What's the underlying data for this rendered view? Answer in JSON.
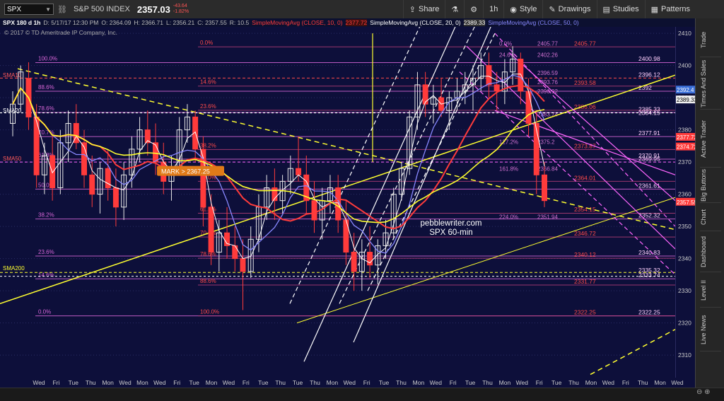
{
  "toolbar": {
    "symbol": "SPX",
    "description": "S&P 500 INDEX",
    "last": "2357.03",
    "change": "-43.64",
    "change_pct": "-1.82%",
    "buttons": [
      {
        "label": "Share",
        "icon": "share-icon"
      },
      {
        "label": "",
        "icon": "flask-icon"
      },
      {
        "label": "",
        "icon": "gear-icon"
      },
      {
        "label": "1h",
        "icon": ""
      },
      {
        "label": "Style",
        "icon": "eye-icon"
      },
      {
        "label": "Drawings",
        "icon": "pencil-icon"
      },
      {
        "label": "Studies",
        "icon": "studies-icon"
      },
      {
        "label": "Patterns",
        "icon": "patterns-icon"
      }
    ]
  },
  "infobar": {
    "title": "SPX 180 d 1h",
    "date": "D: 5/17/17 12:30 PM",
    "open": "O: 2364.09",
    "high": "H: 2366.71",
    "low": "L: 2356.21",
    "close": "C: 2357.55",
    "range": "R: 10.5",
    "sma10": "SimpleMovingAvg (CLOSE, 10, 0)",
    "sma10_val": "2377.72",
    "sma20": "SimpleMovingAvg (CLOSE, 20, 0)",
    "sma20_val": "2389.33",
    "sma50": "SimpleMovingAvg (CLOSE, 50, 0)",
    "copyright": "© 2017 © TD Ameritrade IP Company, Inc."
  },
  "sidebar": [
    "Trade",
    "Times And Sales",
    "Active Trader",
    "Big Buttons",
    "Chart",
    "Dashboard",
    "Level II",
    "Live News"
  ],
  "colors": {
    "background": "#0d0f3a",
    "up": "#e8e8e8",
    "down": "#ff3b3b",
    "fib": "#d866d8",
    "sma10": "#ff3b3b",
    "sma20": "#ffffff",
    "sma50": "#8888ff",
    "ma200": "#ffff30",
    "trend": "#ffff30",
    "channel": "#ffffff",
    "pink_channel": "#ff66ff"
  },
  "chart_data": {
    "type": "candlestick",
    "x_ticks": [
      "Wed",
      "Fri",
      "Tue",
      "Thu",
      "Mon",
      "Wed",
      "Mon",
      "Wed",
      "Fri",
      "Tue",
      "Mon",
      "Wed",
      "Fri",
      "Tue",
      "Thu",
      "Tue",
      "Thu",
      "Mon",
      "Wed",
      "Fri",
      "Tue",
      "Thu",
      "Mon",
      "Wed",
      "Fri",
      "Tue",
      "Thu",
      "Mon",
      "Wed",
      "Fri",
      "Tue",
      "Thu",
      "Mon",
      "Wed",
      "Fri",
      "Thu",
      "Mon",
      "Wed"
    ],
    "y_ticks": [
      2310,
      2320,
      2330,
      2340,
      2350,
      2360,
      2370,
      2380,
      2390,
      2400,
      2410
    ],
    "ylim": [
      2303,
      2412
    ],
    "price_markers": [
      {
        "label": "2392.4",
        "value": 2392.4,
        "color": "#3a6fd8"
      },
      {
        "label": "2389.33",
        "value": 2389.33,
        "color": "#ffffff"
      },
      {
        "label": "2377.72",
        "value": 2377.72,
        "color": "#ff3b3b"
      },
      {
        "label": "2374.72",
        "value": 2374.72,
        "color": "#ff3b3b"
      },
      {
        "label": "2357.55",
        "value": 2357.55,
        "color": "#ff3b3b"
      }
    ],
    "fib_pct_left": [
      {
        "label": "100.0%",
        "value": 2400.9
      },
      {
        "label": "88.6%",
        "value": 2392.0
      },
      {
        "label": "78.6%",
        "value": 2385.4
      },
      {
        "label": "70.7%",
        "value": 2377.9
      },
      {
        "label": "61.8%",
        "value": 2370.9
      },
      {
        "label": "50.0%",
        "value": 2361.6
      },
      {
        "label": "38.2%",
        "value": 2352.3
      },
      {
        "label": "23.6%",
        "value": 2340.8
      },
      {
        "label": "14.6%",
        "value": 2333.7
      },
      {
        "label": "0.0%",
        "value": 2322.2
      }
    ],
    "fib_pct_mid": [
      {
        "label": "0.0%",
        "value": 2405.8
      },
      {
        "label": "14.6%",
        "value": 2393.6
      },
      {
        "label": "23.6%",
        "value": 2386.1
      },
      {
        "label": "38.2%",
        "value": 2373.9
      },
      {
        "label": "50.0%",
        "value": 2364.0
      },
      {
        "label": "61.8%",
        "value": 2354.1
      },
      {
        "label": "70.7%",
        "value": 2346.7
      },
      {
        "label": "78.6%",
        "value": 2340.1
      },
      {
        "label": "88.6%",
        "value": 2331.8
      },
      {
        "label": "100.0%",
        "value": 2322.2
      }
    ],
    "fib_values_red": [
      {
        "label": "2405.77",
        "value": 2405.77
      },
      {
        "label": "2393.58",
        "value": 2393.58
      },
      {
        "label": "2386.06",
        "value": 2386.06
      },
      {
        "label": "2373.87",
        "value": 2373.87
      },
      {
        "label": "2364.01",
        "value": 2364.01
      },
      {
        "label": "2354.15",
        "value": 2354.15
      },
      {
        "label": "2346.72",
        "value": 2346.72
      },
      {
        "label": "2340.12",
        "value": 2340.12
      },
      {
        "label": "2331.77",
        "value": 2331.77
      },
      {
        "label": "2322.25",
        "value": 2322.25
      }
    ],
    "fib_values_pink": [
      {
        "label": "2400.98",
        "value": 2400.98
      },
      {
        "label": "2396.12",
        "value": 2396.12
      },
      {
        "label": "2392",
        "value": 2392.0
      },
      {
        "label": "2385.33",
        "value": 2385.33
      },
      {
        "label": "2384.15",
        "value": 2384.15
      },
      {
        "label": "2377.91",
        "value": 2377.91
      },
      {
        "label": "2370.91",
        "value": 2370.91
      },
      {
        "label": "2369.95",
        "value": 2369.95
      },
      {
        "label": "2361.61",
        "value": 2361.61
      },
      {
        "label": "2352.32",
        "value": 2352.32
      },
      {
        "label": "2340.83",
        "value": 2340.83
      },
      {
        "label": "2335.32",
        "value": 2335.32
      },
      {
        "label": "2333.74",
        "value": 2333.74
      },
      {
        "label": "2322.25",
        "value": 2322.25
      }
    ],
    "ext_labels": [
      {
        "label": "0.0%",
        "value": 2405.77
      },
      {
        "label": "2405.77",
        "value": 2405.77
      },
      {
        "label": "24.6%",
        "value": 2402.26
      },
      {
        "label": "2402.26",
        "value": 2402.26
      },
      {
        "label": "2396.59",
        "value": 2396.59
      },
      {
        "label": "2393.76",
        "value": 2393.76
      },
      {
        "label": "2390.92",
        "value": 2390.92
      },
      {
        "label": "2383.74",
        "value": 2383.74
      },
      {
        "label": "127.2%",
        "value": 2375.2
      },
      {
        "label": "2375.2",
        "value": 2375.2
      },
      {
        "label": "161.8%",
        "value": 2366.84
      },
      {
        "label": "2366.84",
        "value": 2366.84
      },
      {
        "label": "224.0%",
        "value": 2351.94
      },
      {
        "label": "2351.94",
        "value": 2351.94
      }
    ],
    "ma_labels": [
      {
        "label": "SMA10",
        "value": 2396.0
      },
      {
        "label": "SMA20",
        "value": 2385.0
      },
      {
        "label": "SMA50",
        "value": 2370.0
      },
      {
        "label": "SMA200",
        "value": 2336.0
      }
    ],
    "mark_label": "MARK > 2367.25",
    "annotation_line1": "pebblewriter.com",
    "annotation_line2": "SPX 60-min",
    "candles": [
      [
        2382,
        2392,
        2378,
        2388
      ],
      [
        2388,
        2400,
        2386,
        2398
      ],
      [
        2396,
        2401,
        2380,
        2384
      ],
      [
        2384,
        2388,
        2362,
        2366
      ],
      [
        2366,
        2376,
        2360,
        2372
      ],
      [
        2372,
        2378,
        2358,
        2362
      ],
      [
        2362,
        2380,
        2360,
        2376
      ],
      [
        2376,
        2386,
        2370,
        2382
      ],
      [
        2382,
        2388,
        2374,
        2376
      ],
      [
        2376,
        2380,
        2362,
        2366
      ],
      [
        2366,
        2372,
        2356,
        2360
      ],
      [
        2360,
        2370,
        2354,
        2368
      ],
      [
        2368,
        2374,
        2358,
        2362
      ],
      [
        2362,
        2368,
        2350,
        2356
      ],
      [
        2356,
        2370,
        2352,
        2366
      ],
      [
        2366,
        2378,
        2362,
        2374
      ],
      [
        2374,
        2384,
        2370,
        2380
      ],
      [
        2380,
        2386,
        2372,
        2376
      ],
      [
        2376,
        2382,
        2366,
        2370
      ],
      [
        2370,
        2376,
        2360,
        2364
      ],
      [
        2364,
        2372,
        2358,
        2368
      ],
      [
        2368,
        2384,
        2366,
        2380
      ],
      [
        2380,
        2388,
        2376,
        2384
      ],
      [
        2384,
        2386,
        2370,
        2374
      ],
      [
        2374,
        2378,
        2350,
        2356
      ],
      [
        2356,
        2360,
        2338,
        2342
      ],
      [
        2342,
        2352,
        2336,
        2348
      ],
      [
        2348,
        2356,
        2340,
        2344
      ],
      [
        2344,
        2350,
        2336,
        2340
      ],
      [
        2340,
        2346,
        2324,
        2336
      ],
      [
        2336,
        2350,
        2334,
        2346
      ],
      [
        2346,
        2360,
        2342,
        2356
      ],
      [
        2356,
        2366,
        2352,
        2362
      ],
      [
        2362,
        2368,
        2352,
        2358
      ],
      [
        2358,
        2366,
        2354,
        2364
      ],
      [
        2364,
        2372,
        2360,
        2368
      ],
      [
        2368,
        2378,
        2364,
        2366
      ],
      [
        2366,
        2372,
        2354,
        2358
      ],
      [
        2358,
        2364,
        2348,
        2352
      ],
      [
        2352,
        2362,
        2346,
        2358
      ],
      [
        2358,
        2366,
        2354,
        2362
      ],
      [
        2362,
        2366,
        2348,
        2352
      ],
      [
        2352,
        2358,
        2338,
        2342
      ],
      [
        2342,
        2348,
        2330,
        2336
      ],
      [
        2336,
        2346,
        2330,
        2342
      ],
      [
        2342,
        2350,
        2334,
        2338
      ],
      [
        2338,
        2346,
        2332,
        2344
      ],
      [
        2344,
        2352,
        2340,
        2348
      ],
      [
        2348,
        2362,
        2346,
        2360
      ],
      [
        2360,
        2370,
        2358,
        2368
      ],
      [
        2368,
        2386,
        2366,
        2384
      ],
      [
        2384,
        2398,
        2380,
        2394
      ],
      [
        2394,
        2398,
        2384,
        2388
      ],
      [
        2388,
        2394,
        2382,
        2390
      ],
      [
        2390,
        2396,
        2384,
        2386
      ],
      [
        2386,
        2392,
        2380,
        2390
      ],
      [
        2390,
        2396,
        2386,
        2392
      ],
      [
        2392,
        2398,
        2388,
        2394
      ],
      [
        2394,
        2400,
        2386,
        2396
      ],
      [
        2396,
        2404,
        2392,
        2400
      ],
      [
        2400,
        2404,
        2390,
        2394
      ],
      [
        2394,
        2398,
        2386,
        2392
      ],
      [
        2392,
        2402,
        2388,
        2398
      ],
      [
        2398,
        2406,
        2394,
        2402
      ],
      [
        2402,
        2404,
        2388,
        2392
      ],
      [
        2392,
        2396,
        2378,
        2382
      ],
      [
        2382,
        2386,
        2360,
        2366
      ],
      [
        2366,
        2370,
        2356,
        2358
      ]
    ]
  }
}
